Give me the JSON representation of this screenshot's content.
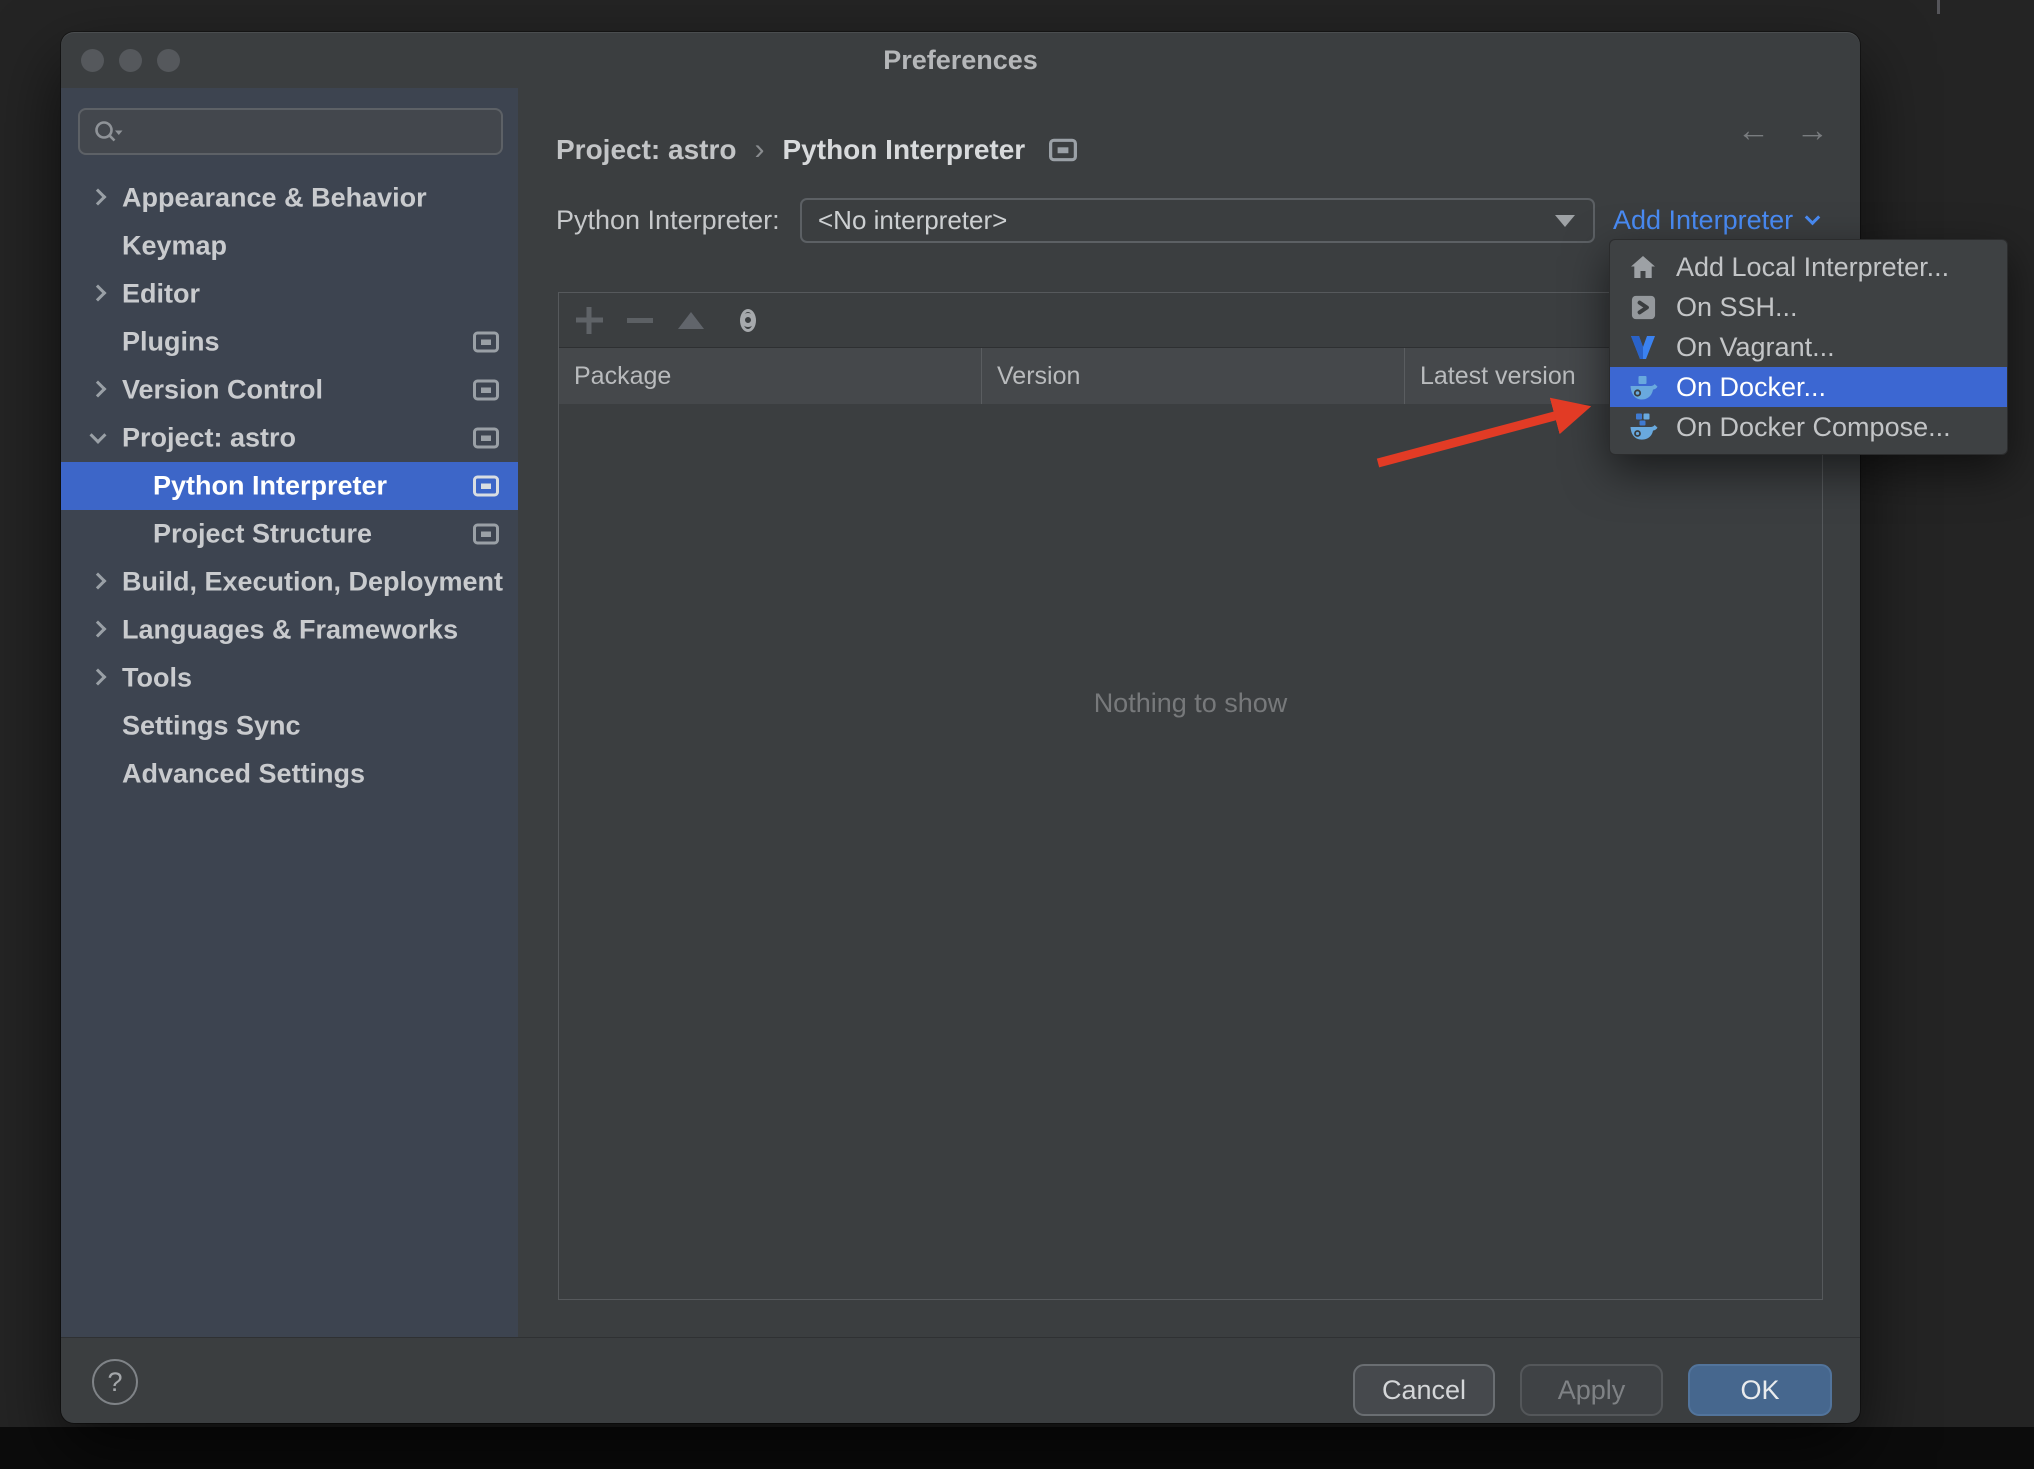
{
  "window": {
    "title": "Preferences"
  },
  "sidebar": {
    "search": {
      "value": ""
    },
    "items": [
      {
        "label": "Appearance & Behavior",
        "expanded": false
      },
      {
        "label": "Keymap"
      },
      {
        "label": "Editor",
        "expanded": false
      },
      {
        "label": "Plugins"
      },
      {
        "label": "Version Control",
        "expanded": false
      },
      {
        "label": "Project: astro",
        "expanded": true
      },
      {
        "label": "Python Interpreter",
        "selected": true
      },
      {
        "label": "Project Structure"
      },
      {
        "label": "Build, Execution, Deployment",
        "expanded": false
      },
      {
        "label": "Languages & Frameworks",
        "expanded": false
      },
      {
        "label": "Tools",
        "expanded": false
      },
      {
        "label": "Settings Sync"
      },
      {
        "label": "Advanced Settings"
      }
    ]
  },
  "breadcrumb": {
    "project": "Project: astro",
    "separator": "›",
    "page": "Python Interpreter"
  },
  "header_nav": {
    "back": "←",
    "forward": "→"
  },
  "interpreter": {
    "label": "Python Interpreter:",
    "value": "<No interpreter>",
    "add_link": "Add Interpreter"
  },
  "add_menu": {
    "items": [
      {
        "label": "Add Local Interpreter...",
        "icon": "home-icon",
        "highlighted": false
      },
      {
        "label": "On SSH...",
        "icon": "ssh-icon",
        "highlighted": false
      },
      {
        "label": "On Vagrant...",
        "icon": "vagrant-icon",
        "highlighted": false
      },
      {
        "label": "On Docker...",
        "icon": "docker-icon",
        "highlighted": true
      },
      {
        "label": "On Docker Compose...",
        "icon": "docker-compose-icon",
        "highlighted": false
      }
    ]
  },
  "package_table": {
    "columns": [
      "Package",
      "Version",
      "Latest version"
    ],
    "toolbar": [
      "add",
      "remove",
      "upgrade",
      "show-early-releases"
    ],
    "empty_text": "Nothing to show"
  },
  "footer": {
    "help": "?",
    "cancel": "Cancel",
    "apply": "Apply",
    "ok": "OK"
  },
  "colors": {
    "selection_blue": "#3d66c8",
    "menu_highlight": "#3c67d2",
    "link_blue": "#4a8cf5",
    "ok_button": "#46678e",
    "arrow_red": "#e23b25",
    "sidebar_bg": "#3d4450",
    "dialog_bg": "#3b3e40"
  }
}
